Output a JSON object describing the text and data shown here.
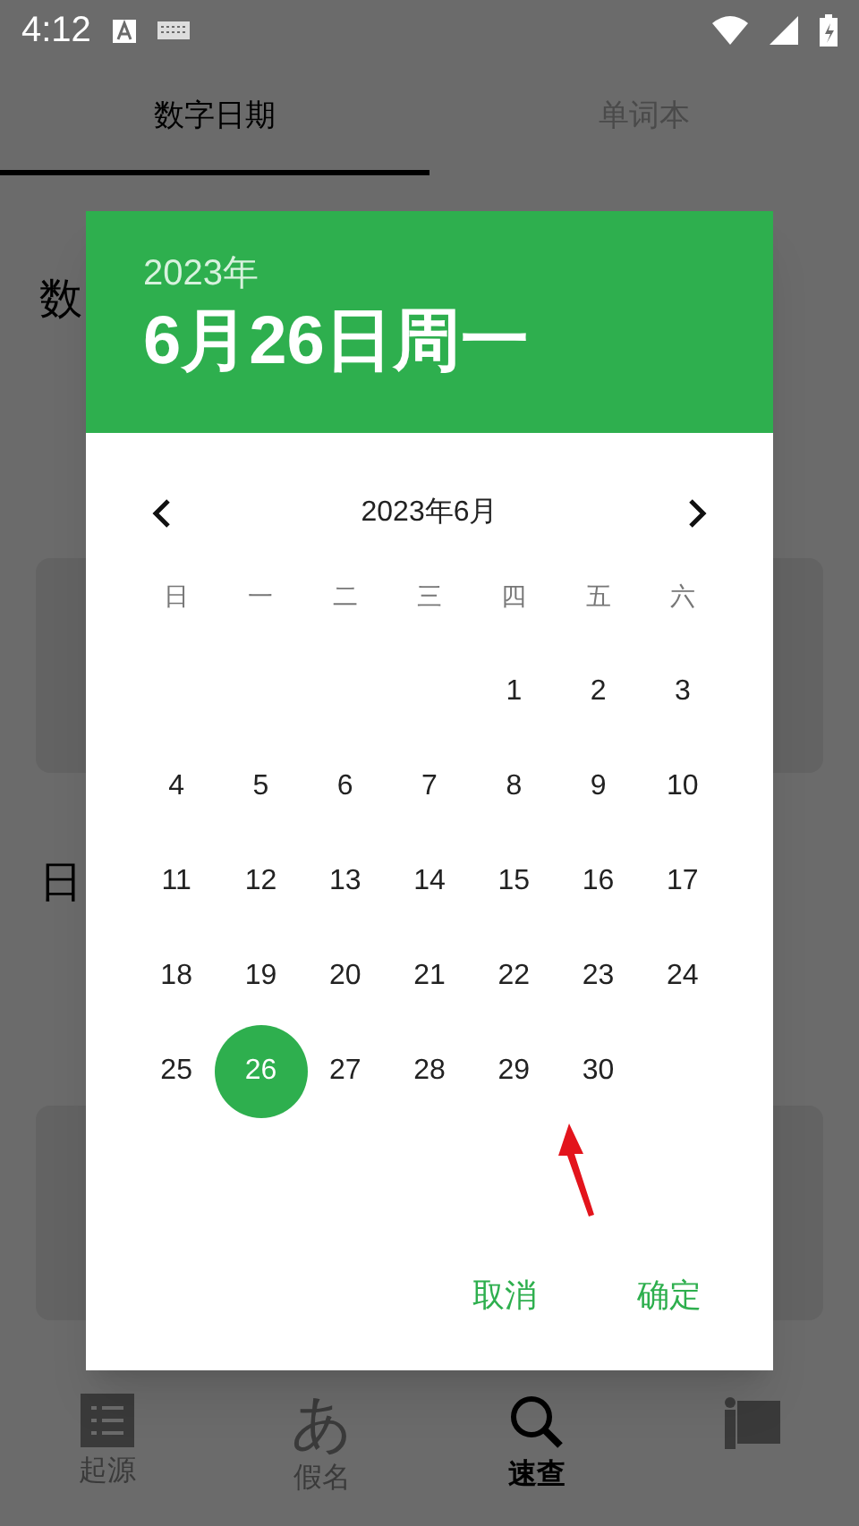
{
  "status_bar": {
    "time": "4:12"
  },
  "tabs": [
    {
      "label": "数字日期",
      "selected": true
    },
    {
      "label": "单词本",
      "selected": false
    }
  ],
  "background_headings": [
    "数",
    "日"
  ],
  "dialog": {
    "year": "2023年",
    "date": "6月26日周一",
    "month": "2023年6月",
    "weekdays": [
      "日",
      "一",
      "二",
      "三",
      "四",
      "五",
      "六"
    ],
    "weeks": [
      [
        {
          "kind": "blank"
        },
        {
          "kind": "blank"
        },
        {
          "kind": "blank"
        },
        {
          "kind": "blank"
        },
        {
          "kind": "day",
          "day": "1",
          "selected": false
        },
        {
          "kind": "day",
          "day": "2",
          "selected": false
        },
        {
          "kind": "day",
          "day": "3",
          "selected": false
        }
      ],
      [
        {
          "kind": "day",
          "day": "4",
          "selected": false
        },
        {
          "kind": "day",
          "day": "5",
          "selected": false
        },
        {
          "kind": "day",
          "day": "6",
          "selected": false
        },
        {
          "kind": "day",
          "day": "7",
          "selected": false
        },
        {
          "kind": "day",
          "day": "8",
          "selected": false
        },
        {
          "kind": "day",
          "day": "9",
          "selected": false
        },
        {
          "kind": "day",
          "day": "10",
          "selected": false
        }
      ],
      [
        {
          "kind": "day",
          "day": "11",
          "selected": false
        },
        {
          "kind": "day",
          "day": "12",
          "selected": false
        },
        {
          "kind": "day",
          "day": "13",
          "selected": false
        },
        {
          "kind": "day",
          "day": "14",
          "selected": false
        },
        {
          "kind": "day",
          "day": "15",
          "selected": false
        },
        {
          "kind": "day",
          "day": "16",
          "selected": false
        },
        {
          "kind": "day",
          "day": "17",
          "selected": false
        }
      ],
      [
        {
          "kind": "day",
          "day": "18",
          "selected": false
        },
        {
          "kind": "day",
          "day": "19",
          "selected": false
        },
        {
          "kind": "day",
          "day": "20",
          "selected": false
        },
        {
          "kind": "day",
          "day": "21",
          "selected": false
        },
        {
          "kind": "day",
          "day": "22",
          "selected": false
        },
        {
          "kind": "day",
          "day": "23",
          "selected": false
        },
        {
          "kind": "day",
          "day": "24",
          "selected": false
        }
      ],
      [
        {
          "kind": "day",
          "day": "25",
          "selected": false
        },
        {
          "kind": "day",
          "day": "26",
          "selected": true
        },
        {
          "kind": "day",
          "day": "27",
          "selected": false
        },
        {
          "kind": "day",
          "day": "28",
          "selected": false
        },
        {
          "kind": "day",
          "day": "29",
          "selected": false
        },
        {
          "kind": "day",
          "day": "30",
          "selected": false
        }
      ]
    ],
    "buttons": [
      "取消",
      "确定"
    ]
  },
  "bottom_nav": [
    {
      "kind": "list",
      "label": "起源",
      "selected": false
    },
    {
      "kind": "kana",
      "glyph": "あ",
      "label": "假名",
      "selected": false
    },
    {
      "kind": "search",
      "label": "速查",
      "selected": true
    },
    {
      "kind": "board",
      "selected": false
    }
  ]
}
